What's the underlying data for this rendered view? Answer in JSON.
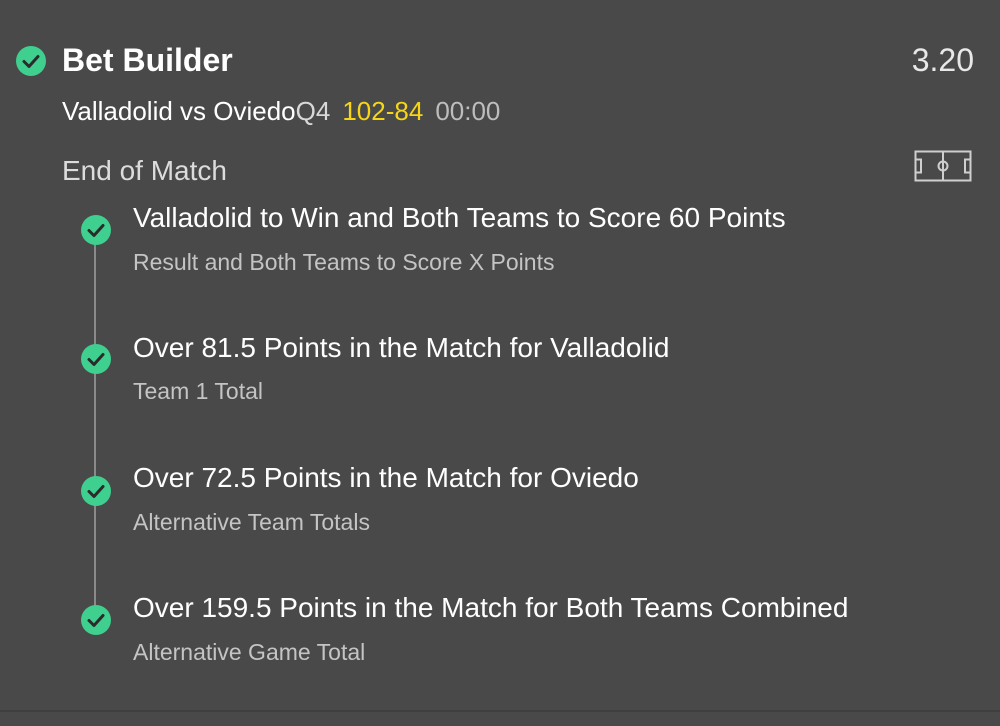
{
  "bet": {
    "title": "Bet Builder",
    "odds": "3.20"
  },
  "match": {
    "teams": "Valladolid vs Oviedo",
    "period": "Q4",
    "score": "102-84",
    "clock": "00:00"
  },
  "section": {
    "label": "End of Match"
  },
  "selections": [
    {
      "title": "Valladolid to Win and Both Teams to Score 60 Points",
      "market": "Result and Both Teams to Score X Points"
    },
    {
      "title": "Over 81.5 Points in the Match for Valladolid",
      "market": "Team 1 Total"
    },
    {
      "title": "Over 72.5 Points in the Match for Oviedo",
      "market": "Alternative Team Totals"
    },
    {
      "title": "Over 159.5 Points in the Match for Both Teams Combined",
      "market": "Alternative Game Total"
    }
  ],
  "icons": {
    "header_check": "check-circle-icon",
    "selection_check": "check-circle-icon",
    "pitch": "pitch-icon"
  },
  "colors": {
    "background": "#494949",
    "check_green": "#3fcf8e",
    "score_yellow": "#f5d516"
  }
}
